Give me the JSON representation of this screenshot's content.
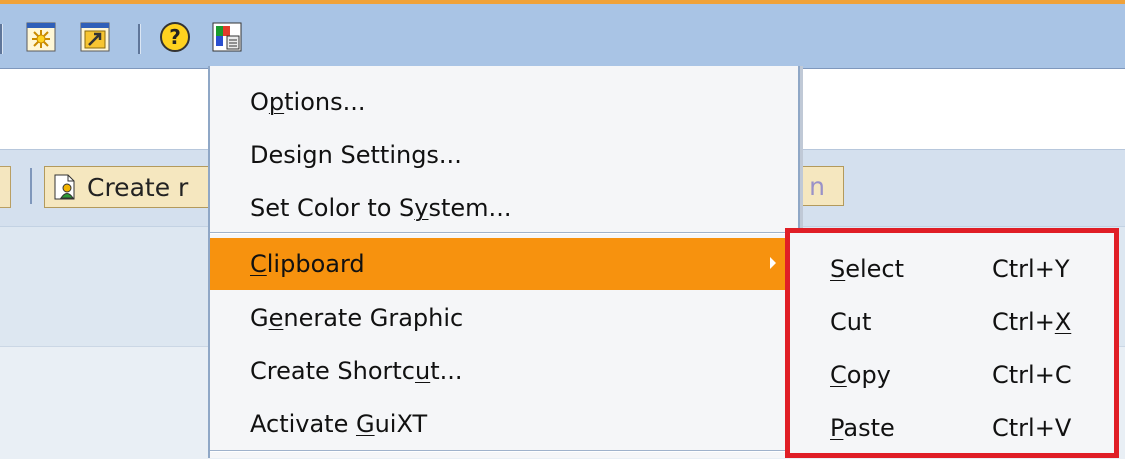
{
  "colors": {
    "toolbar_bg": "#a9c4e5",
    "menu_highlight": "#f7920e",
    "submenu_border": "#e01e26"
  },
  "toolbar": {
    "icons": [
      "create-session-icon",
      "generate-shortcut-icon",
      "help-icon",
      "customize-layout-icon"
    ]
  },
  "app_toolbar": {
    "create_button_label": "Create r",
    "right_button_label": "n"
  },
  "menu": {
    "items": [
      {
        "pre": "O",
        "ul": "p",
        "post": "tions..."
      },
      {
        "pre": "Design Settings...",
        "ul": "",
        "post": ""
      },
      {
        "pre": "Set Color to S",
        "ul": "y",
        "post": "stem..."
      },
      {
        "pre": "",
        "ul": "C",
        "post": "lipboard"
      },
      {
        "pre": "G",
        "ul": "e",
        "post": "nerate Graphic"
      },
      {
        "pre": "Create Shortc",
        "ul": "u",
        "post": "t..."
      },
      {
        "pre": "Activate ",
        "ul": "G",
        "post": "uiXT"
      }
    ]
  },
  "submenu": {
    "items": [
      {
        "label_pre": "",
        "label_ul": "S",
        "label_post": "elect",
        "sc_pre": "Ctrl+Y",
        "sc_ul": "",
        "sc_post": ""
      },
      {
        "label_pre": "Cut",
        "label_ul": "",
        "label_post": "",
        "sc_pre": "Ctrl+",
        "sc_ul": "X",
        "sc_post": ""
      },
      {
        "label_pre": "",
        "label_ul": "C",
        "label_post": "opy",
        "sc_pre": "Ctrl+C",
        "sc_ul": "",
        "sc_post": ""
      },
      {
        "label_pre": "",
        "label_ul": "P",
        "label_post": "aste",
        "sc_pre": "Ctrl+V",
        "sc_ul": "",
        "sc_post": ""
      }
    ]
  }
}
